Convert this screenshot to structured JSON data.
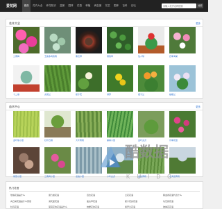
{
  "header": {
    "logo": "爱花网",
    "nav": [
      "首页",
      "花卉大全",
      "养花知识",
      "盆景",
      "园林",
      "花语",
      "种植",
      "病虫害",
      "花艺",
      "图库",
      "百科",
      "论坛"
    ],
    "search_placeholder": "请输入花卉名称搜索",
    "search_button": "搜索"
  },
  "section1": {
    "title": "花卉大全",
    "more": "更多",
    "items": [
      {
        "caption": "三角梅"
      },
      {
        "caption": "玉露多肉植物"
      },
      {
        "caption": "黑法师"
      },
      {
        "caption": "铜钱草"
      },
      {
        "caption": "仙人球"
      },
      {
        "caption": "四季海棠"
      },
      {
        "caption": "十二卷"
      },
      {
        "caption": "虎尾兰"
      },
      {
        "caption": "栀子花"
      },
      {
        "caption": "绿萝"
      },
      {
        "caption": "君子兰"
      },
      {
        "caption": "蝴蝶兰"
      }
    ]
  },
  "section2": {
    "title": "苗木中心",
    "more": "更多",
    "items": [
      {
        "caption": "金叶榆小苗"
      },
      {
        "caption": "红叶石楠"
      },
      {
        "caption": "大叶黄杨"
      },
      {
        "caption": "垂柳小苗"
      },
      {
        "caption": "金叶女贞"
      },
      {
        "caption": "月季花苗"
      },
      {
        "caption": "紫薇小苗"
      },
      {
        "caption": "三角梅小苗"
      },
      {
        "caption": "龙柏小苗"
      },
      {
        "caption": "小叶女贞"
      },
      {
        "caption": "金边黄杨"
      },
      {
        "caption": "北海道黄杨"
      }
    ]
  },
  "bottom": {
    "title": "热门花语",
    "links": [
      "玫瑰花语是什么",
      "康乃馨花语",
      "百合花语",
      "兰花花语",
      "郁金香花语代表什么",
      "向日葵花语是什么意思",
      "满天星花语",
      "薰衣草花语",
      "栀子花的花语",
      "勿忘我花语",
      "牡丹花语",
      "茉莉花的花语是什么",
      "桔梗花的花语",
      "紫罗兰花语",
      "彼岸花花语"
    ]
  },
  "watermark": {
    "cn": "酷数据",
    "en": "KUIDC"
  }
}
